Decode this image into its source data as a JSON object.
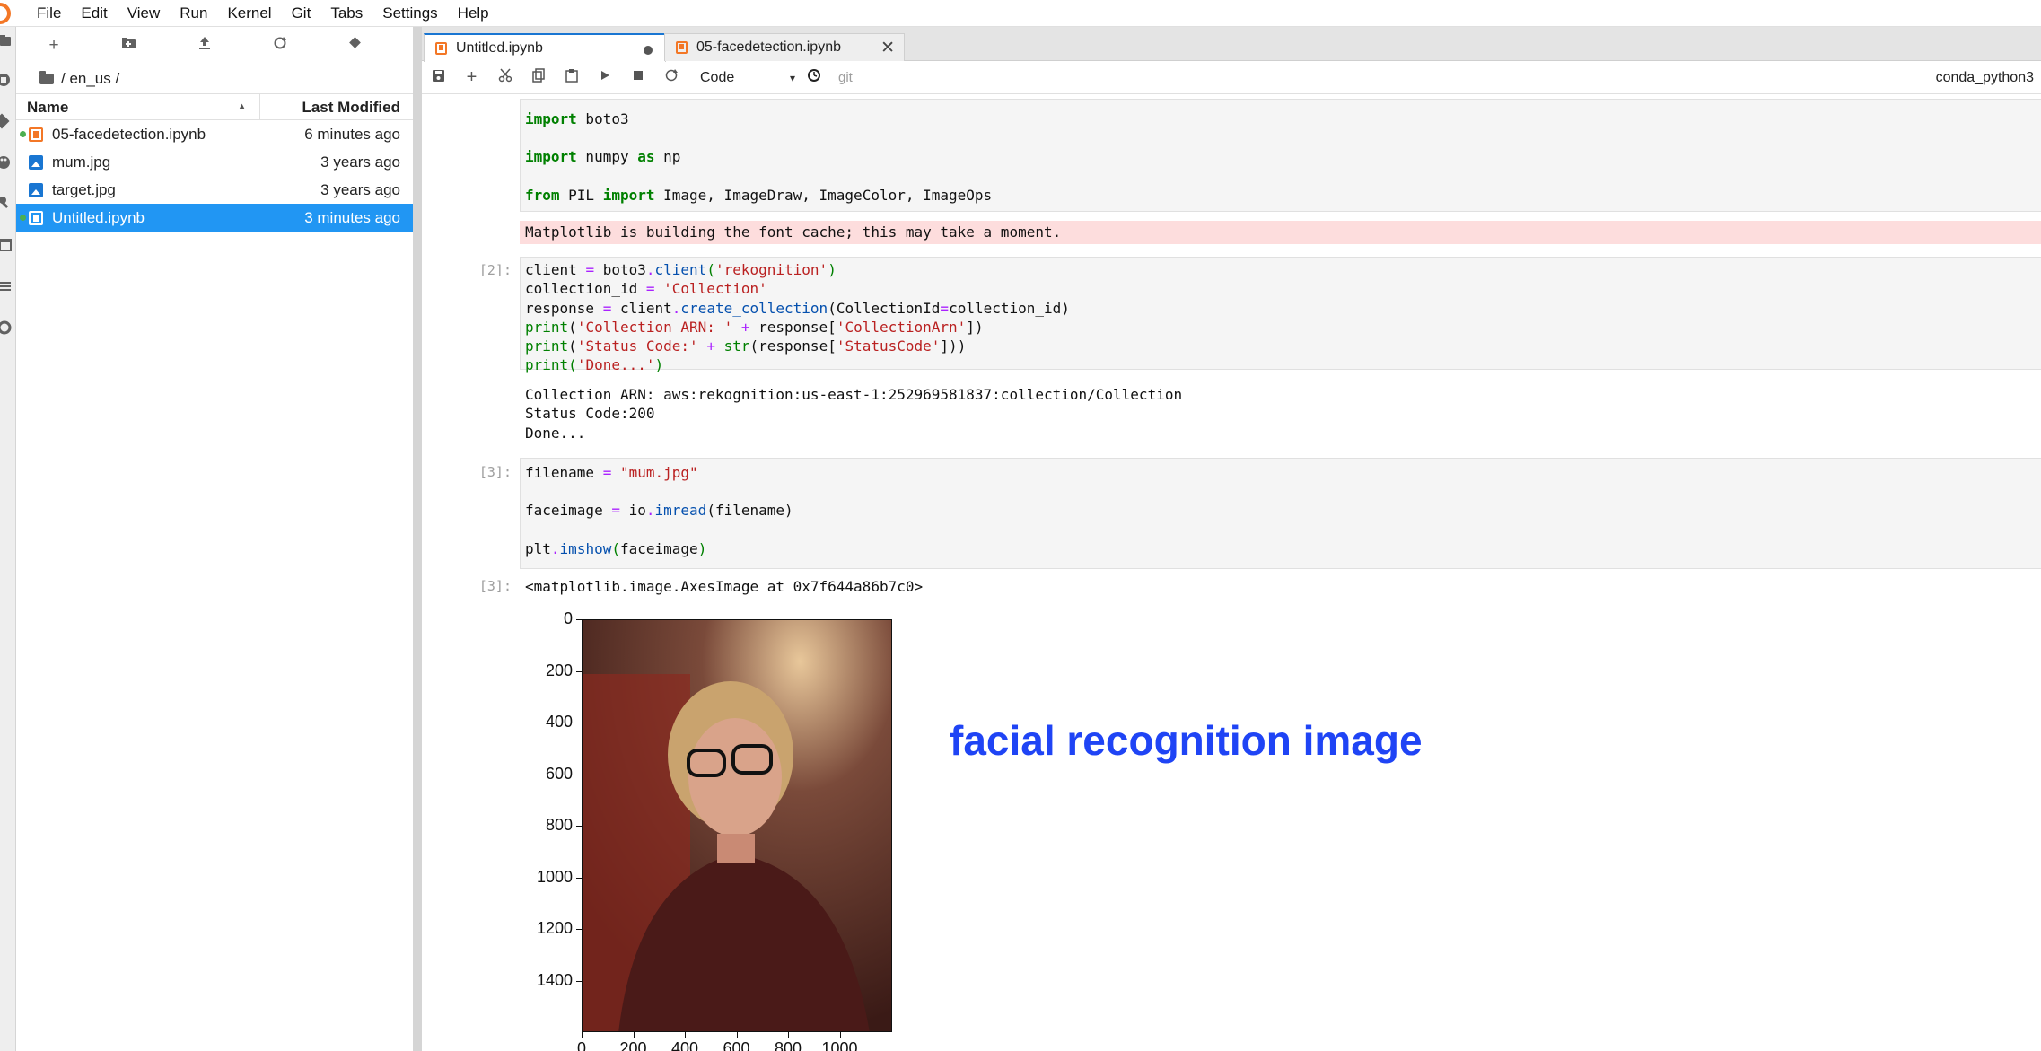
{
  "menubar": {
    "items": [
      "File",
      "Edit",
      "View",
      "Run",
      "Kernel",
      "Git",
      "Tabs",
      "Settings",
      "Help"
    ]
  },
  "filebrowser": {
    "breadcrumb": "/ en_us /",
    "columns": {
      "name": "Name",
      "modified": "Last Modified"
    },
    "files": [
      {
        "name": "05-facedetection.ipynb",
        "modified": "6 minutes ago",
        "type": "notebook",
        "running": true,
        "selected": false
      },
      {
        "name": "mum.jpg",
        "modified": "3 years ago",
        "type": "image",
        "running": false,
        "selected": false
      },
      {
        "name": "target.jpg",
        "modified": "3 years ago",
        "type": "image",
        "running": false,
        "selected": false
      },
      {
        "name": "Untitled.ipynb",
        "modified": "3 minutes ago",
        "type": "notebook",
        "running": true,
        "selected": true
      }
    ]
  },
  "tabs": [
    {
      "label": "Untitled.ipynb",
      "active": true
    },
    {
      "label": "05-facedetection.ipynb",
      "active": false
    }
  ],
  "toolbar": {
    "cell_type": "Code",
    "git_label": "git",
    "kernel": "conda_python3"
  },
  "cells": {
    "cell1_lines": [
      "import boto3",
      "",
      "import numpy as np",
      "",
      "from PIL import Image, ImageDraw, ImageColor, ImageOps"
    ],
    "cell1_stderr": "Matplotlib is building the font cache; this may take a moment.",
    "cell2_prompt": "[2]:",
    "cell2_output": [
      "Collection ARN: aws:rekognition:us-east-1:252969581837:collection/Collection",
      "Status Code:200",
      "Done..."
    ],
    "cell3_prompt": "[3]:",
    "cell3_out_prompt": "[3]:",
    "cell3_output": "<matplotlib.image.AxesImage at 0x7f644a86b7c0>"
  },
  "plot": {
    "yticks": [
      "0",
      "200",
      "400",
      "600",
      "800",
      "1000",
      "1200",
      "1400"
    ],
    "xticks": [
      "0",
      "200",
      "400",
      "600",
      "800",
      "1000"
    ],
    "annotation": "facial recognition image",
    "annotation_color": "#1f44f5"
  }
}
